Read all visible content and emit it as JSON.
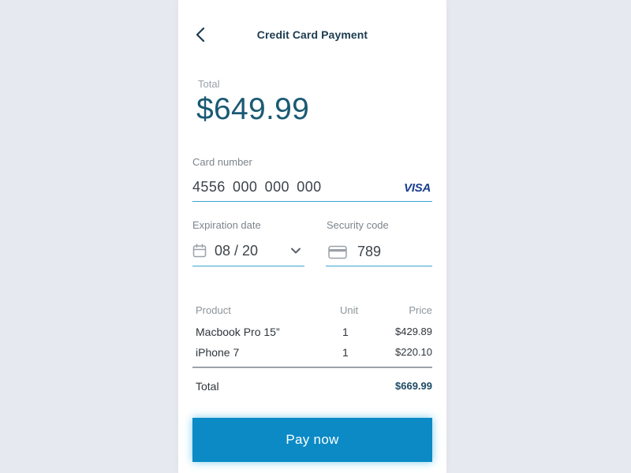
{
  "header": {
    "title": "Credit Card Payment"
  },
  "summary": {
    "total_label": "Total",
    "total_amount": "$649.99"
  },
  "card_number": {
    "label": "Card number",
    "value": "4556  000  000  000",
    "brand": "VISA"
  },
  "expiration": {
    "label": "Expiration date",
    "value": "08 / 20"
  },
  "security": {
    "label": "Security code",
    "value": "789"
  },
  "order_table": {
    "headers": {
      "product": "Product",
      "unit": "Unit",
      "price": "Price"
    },
    "rows": [
      {
        "product": "Macbook Pro 15”",
        "unit": "1",
        "price": "$429.89"
      },
      {
        "product": "iPhone 7",
        "unit": "1",
        "price": "$220.10"
      }
    ],
    "total_label": "Total",
    "total_value": "$669.99"
  },
  "actions": {
    "pay_label": "Pay now"
  },
  "colors": {
    "accent": "#0b8ac6",
    "underline": "#3ba3d0",
    "amount": "#1a5a73",
    "background": "#e6e9ef"
  },
  "icons": {
    "back": "chevron-left-icon",
    "calendar": "calendar-icon",
    "dropdown": "chevron-down-icon",
    "card": "credit-card-icon"
  }
}
